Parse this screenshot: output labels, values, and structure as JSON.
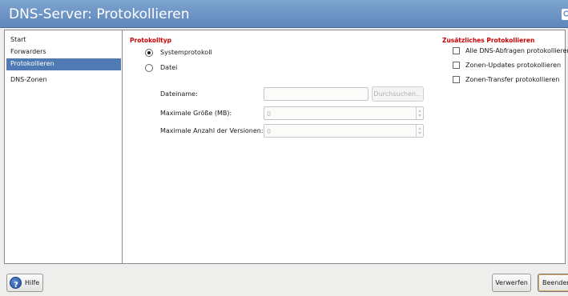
{
  "window": {
    "title": "DNS-Server: Protokollieren"
  },
  "sidebar": {
    "items": [
      {
        "label": "Start"
      },
      {
        "label": "Forwarders"
      },
      {
        "label": "Protokollieren"
      },
      {
        "label": "DNS-Zonen"
      }
    ],
    "selected": "Protokollieren"
  },
  "protokolltyp": {
    "heading": "Protokolltyp",
    "options": [
      {
        "label": "Systemprotokoll",
        "selected": true
      },
      {
        "label": "Datei",
        "selected": false
      }
    ],
    "dateiname": {
      "label": "Dateiname:",
      "value": "",
      "browse_label": "Durchsuchen..."
    },
    "max_size": {
      "label": "Maximale Größe (MB):",
      "value": "0"
    },
    "max_versions": {
      "label": "Maximale Anzahl der Versionen:",
      "value": "0"
    }
  },
  "zusaetzlich": {
    "heading": "Zusätzliches Protokollieren",
    "options": [
      {
        "label": "Alle DNS-Abfragen protokollieren",
        "checked": false
      },
      {
        "label": "Zonen-Updates protokollieren",
        "checked": false
      },
      {
        "label": "Zonen-Transfer protokollieren",
        "checked": false
      }
    ]
  },
  "footer": {
    "help_label": "Hilfe",
    "discard_label": "Verwerfen",
    "finish_label": "Beenden"
  },
  "icons": {
    "help": "help-icon",
    "title_help": "title-help-icon"
  },
  "colors": {
    "title_bar": "#6b92c3",
    "selection": "#4f7ab3",
    "section_heading": "#cc0000"
  }
}
